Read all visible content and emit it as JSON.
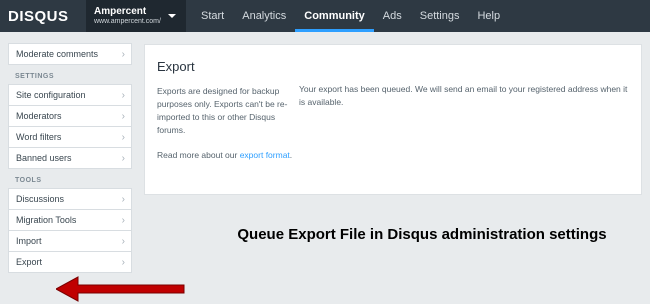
{
  "brand": "DISQUS",
  "site": {
    "name": "Ampercent",
    "url": "www.ampercent.com/"
  },
  "nav": [
    {
      "label": "Start"
    },
    {
      "label": "Analytics"
    },
    {
      "label": "Community"
    },
    {
      "label": "Ads"
    },
    {
      "label": "Settings"
    },
    {
      "label": "Help"
    }
  ],
  "sidebar": {
    "top_items": [
      {
        "label": "Moderate comments"
      }
    ],
    "settings_heading": "SETTINGS",
    "settings_items": [
      {
        "label": "Site configuration"
      },
      {
        "label": "Moderators"
      },
      {
        "label": "Word filters"
      },
      {
        "label": "Banned users"
      }
    ],
    "tools_heading": "TOOLS",
    "tools_items": [
      {
        "label": "Discussions"
      },
      {
        "label": "Migration Tools"
      },
      {
        "label": "Import"
      },
      {
        "label": "Export"
      }
    ]
  },
  "panel": {
    "title": "Export",
    "description": "Exports are designed for backup purposes only. Exports can't be re-imported to this or other Disqus forums.",
    "read_more_prefix": "Read more about our ",
    "read_more_link": "export format",
    "read_more_suffix": ".",
    "message": "Your export has been queued. We will send an email to your registered address when it is available."
  },
  "annotation": {
    "caption": "Queue Export File in Disqus administration settings",
    "arrow_color": "#c00000"
  },
  "colors": {
    "topbar": "#2e3943",
    "accent": "#2e9fff"
  }
}
